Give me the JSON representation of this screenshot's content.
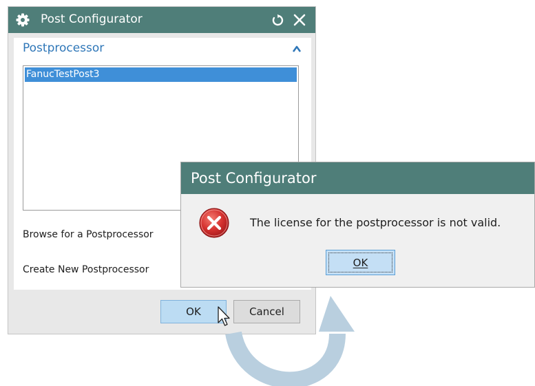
{
  "main_dialog": {
    "title": "Post Configurator",
    "section_title": "Postprocessor",
    "list_items": [
      "FanucTestPost3"
    ],
    "browse_label": "Browse for a Postprocessor",
    "create_label": "Create New Postprocessor",
    "ok_label": "OK",
    "cancel_label": "Cancel"
  },
  "error_dialog": {
    "title": "Post Configurator",
    "message": "The license for the postprocessor is not valid.",
    "ok_label": "OK"
  },
  "icons": {
    "title": "gear-icon",
    "reset": "reset-icon",
    "close": "close-icon",
    "collapse": "chevron-up-icon",
    "error": "error-icon",
    "cursor": "mouse-cursor-icon",
    "arrow": "curved-arrow-icon"
  },
  "colors": {
    "titlebar": "#4f7e79",
    "accent_text": "#2f77b8",
    "selection": "#3f8fd8",
    "error_red": "#c7282b",
    "arrow": "#b9cfdf"
  }
}
